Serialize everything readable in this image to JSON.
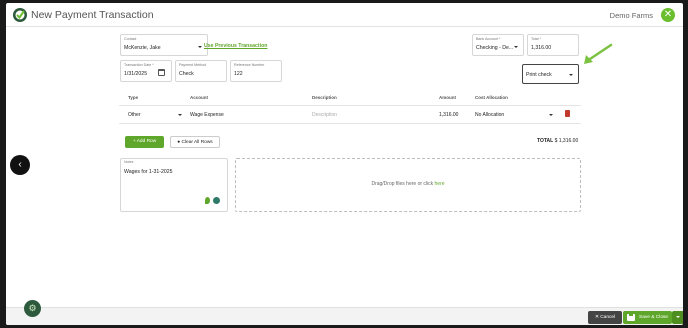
{
  "app": {
    "title": "New Payment Transaction",
    "company": "Demo Farms",
    "brand_color": "#6bbf2f"
  },
  "form": {
    "contact": {
      "label": "Contact",
      "value": "McKenzie, Jake"
    },
    "use_previous_link": "Use Previous Transaction",
    "bank_account": {
      "label": "Bank Account *",
      "value": "Checking - De..."
    },
    "total": {
      "label": "Total *",
      "value": "1,316.00"
    },
    "transaction_date": {
      "label": "Transaction Date *",
      "value": "1/31/2025"
    },
    "payment_method": {
      "label": "Payment Method",
      "value": "Check"
    },
    "reference_number": {
      "label": "Reference Number",
      "value": "122"
    },
    "print_option": {
      "value": "Print check"
    }
  },
  "table": {
    "headers": {
      "type": "Type",
      "account": "Account",
      "description": "Description",
      "amount": "Amount",
      "cost_allocation": "Cost Allocation"
    },
    "rows": [
      {
        "type": "Other",
        "account": "Wage Expense",
        "description_placeholder": "Description",
        "amount": "1,316.00",
        "cost_allocation": "No Allocation"
      }
    ]
  },
  "actions": {
    "add_row": "Add Row",
    "clear_rows": "Clear All Rows",
    "total_label": "TOTAL",
    "total_value": "$ 1,316.00"
  },
  "notes": {
    "label": "Notes",
    "value": "Wages for 1-31-2025"
  },
  "dropzone": {
    "text": "Drag/Drop files here or click",
    "link": "here"
  },
  "footer": {
    "cancel": "Cancel",
    "save": "Save & Close"
  }
}
